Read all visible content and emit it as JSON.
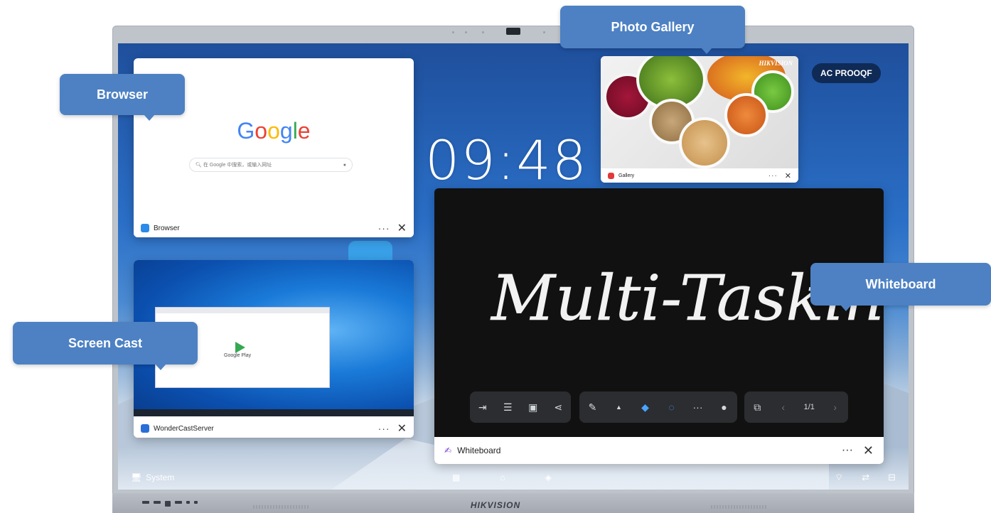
{
  "device": {
    "brand": "HIKVISION",
    "device_id": "AC PROOQF",
    "clock": "09:48"
  },
  "windows": {
    "browser": {
      "title": "Browser",
      "google_logo": "Google",
      "search_placeholder": "在 Google 中搜索，或输入网址"
    },
    "gallery": {
      "title": "Gallery",
      "brand_watermark": "HIKVISION"
    },
    "screen_cast": {
      "title": "WonderCastServer",
      "content_label": "Google Play"
    },
    "whiteboard": {
      "title": "Whiteboard",
      "handwriting": "Multi-Tasking",
      "page_indicator": "1/1"
    }
  },
  "window_controls": {
    "more": "···",
    "close": "✕"
  },
  "taskbar": {
    "system_label": "System"
  },
  "callouts": {
    "browser": "Browser",
    "photo_gallery": "Photo Gallery",
    "screen_cast": "Screen Cast",
    "whiteboard": "Whiteboard"
  },
  "colors": {
    "callout_bg": "#4d81c3",
    "device_id_bg": "#0f2a55",
    "whiteboard_bg": "#111111",
    "screen_blue": "#2a6fc7"
  },
  "icons": {
    "whiteboard_toolbar": [
      "exit-icon",
      "menu-icon",
      "save-icon",
      "share-icon",
      "pen-icon",
      "caret-up-icon",
      "eraser-icon",
      "lasso-select-icon",
      "more-dots-icon",
      "circle-more-icon",
      "add-page-icon",
      "prev-page-icon",
      "next-page-icon"
    ],
    "taskbar": [
      "system-icon",
      "apps-grid-icon",
      "home-icon",
      "layers-icon",
      "wifi-icon",
      "transfer-icon",
      "toolbox-icon"
    ]
  }
}
